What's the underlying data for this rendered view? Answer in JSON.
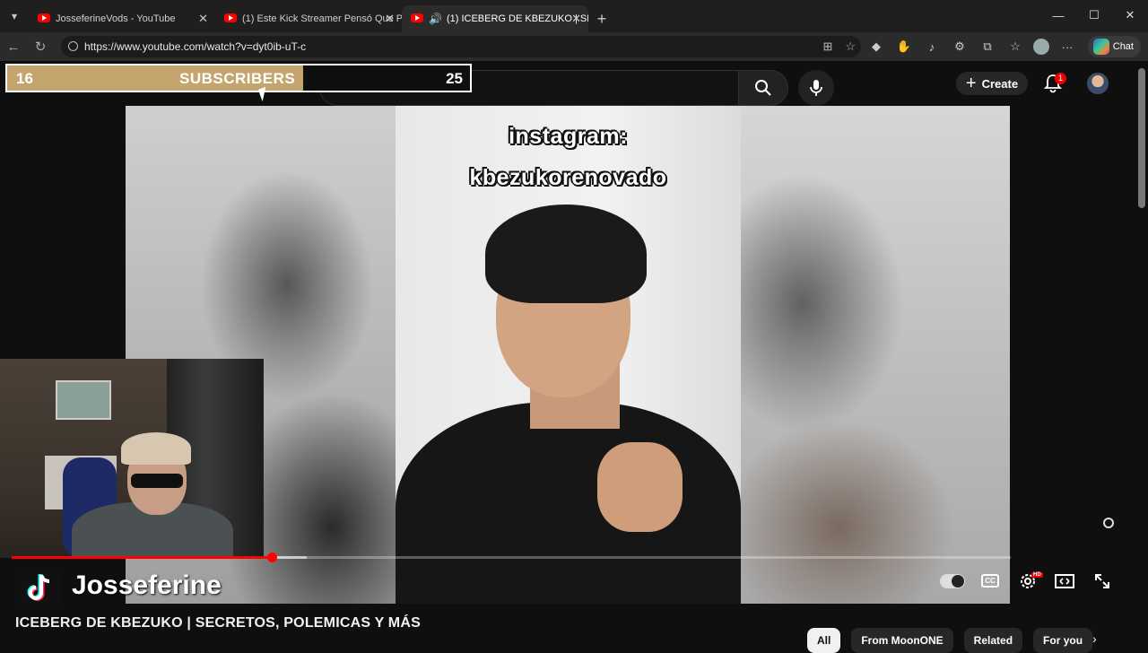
{
  "browser": {
    "tabs": [
      {
        "title": "JosseferineVods - YouTube",
        "active": false
      },
      {
        "title": "(1) Este Kick Streamer Pensó Que P",
        "active": false
      },
      {
        "title": "(1) ICEBERG DE KBEZUKO | SE",
        "active": true
      }
    ],
    "url": "https://www.youtube.com/watch?v=dyt0ib-uT-c",
    "copilot_label": "Chat"
  },
  "youtube": {
    "search_placeholder": "Search",
    "create_label": "Create",
    "notification_count": "1"
  },
  "subscriber_overlay": {
    "count": "16",
    "label": "SUBSCRIBERS",
    "goal": "25",
    "progress_fraction": 0.64,
    "fill_color": "#c4a56e"
  },
  "video": {
    "overlay_line1": "instagram:",
    "overlay_line2": "kbezukorenovado",
    "played_fraction": 0.26,
    "buffered_fraction": 0.295,
    "channel_name": "Josseferine",
    "title": "ICEBERG DE KBEZUKO | SECRETOS, POLEMICAS Y MÁS",
    "cc_label": "CC",
    "hd_label": "HD"
  },
  "chips": [
    "All",
    "From MoonONE",
    "Related",
    "For you"
  ],
  "colors": {
    "accent": "#ff0000",
    "background": "#0f0f0f"
  }
}
